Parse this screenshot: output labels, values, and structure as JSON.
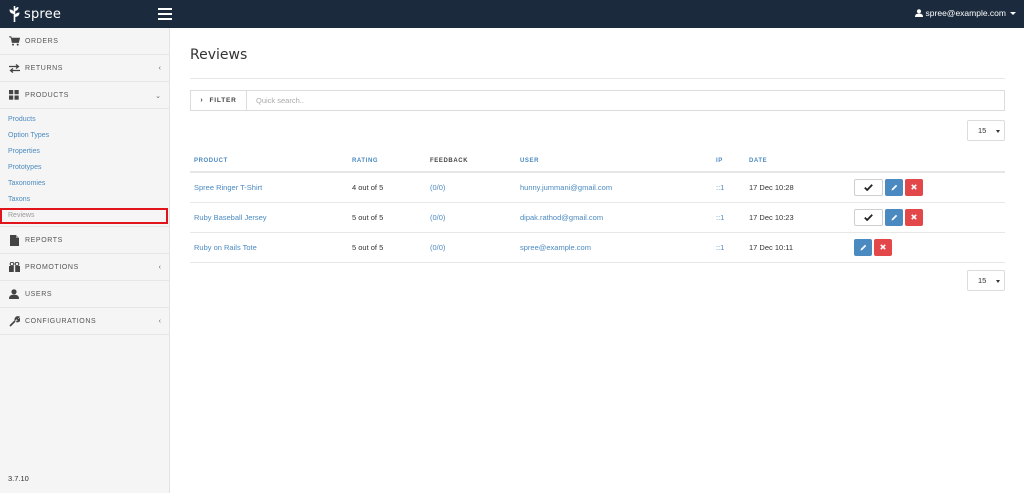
{
  "header": {
    "logo_text": "spree",
    "user_email": "spree@example.com",
    "icons": {
      "logo": "spree-logo-icon",
      "menu": "hamburger-menu-icon",
      "user": "user-icon"
    }
  },
  "sidebar": {
    "items": [
      {
        "label": "ORDERS",
        "icon": "cart-icon",
        "has_chevron": false
      },
      {
        "label": "RETURNS",
        "icon": "exchange-icon",
        "has_chevron": true
      },
      {
        "label": "PRODUCTS",
        "icon": "grid-icon",
        "has_chevron": true,
        "expanded": true
      },
      {
        "label": "REPORTS",
        "icon": "file-icon",
        "has_chevron": false
      },
      {
        "label": "PROMOTIONS",
        "icon": "gift-icon",
        "has_chevron": true
      },
      {
        "label": "USERS",
        "icon": "user-icon",
        "has_chevron": false
      },
      {
        "label": "CONFIGURATIONS",
        "icon": "wrench-icon",
        "has_chevron": true
      }
    ],
    "products_submenu": [
      {
        "label": "Products"
      },
      {
        "label": "Option Types"
      },
      {
        "label": "Properties"
      },
      {
        "label": "Prototypes"
      },
      {
        "label": "Taxonomies"
      },
      {
        "label": "Taxons"
      },
      {
        "label": "Reviews",
        "active": true
      }
    ],
    "version": "3.7.10"
  },
  "main": {
    "title": "Reviews",
    "filter": {
      "label": "FILTER",
      "placeholder": "Quick search.."
    },
    "per_page": "15",
    "table": {
      "columns": [
        "PRODUCT",
        "RATING",
        "FEEDBACK",
        "USER",
        "IP",
        "DATE"
      ],
      "rows": [
        {
          "product": "Spree Ringer T-Shirt",
          "rating": "4 out of 5",
          "feedback": "(0/0)",
          "user": "hunny.jummani@gmail.com",
          "ip": "::1",
          "date": "17 Dec 10:28",
          "approve": true
        },
        {
          "product": "Ruby Baseball Jersey",
          "rating": "5 out of 5",
          "feedback": "(0/0)",
          "user": "dipak.rathod@gmail.com",
          "ip": "::1",
          "date": "17 Dec 10:23",
          "approve": true
        },
        {
          "product": "Ruby on Rails Tote",
          "rating": "5 out of 5",
          "feedback": "(0/0)",
          "user": "spree@example.com",
          "ip": "::1",
          "date": "17 Dec 10:11",
          "approve": false
        }
      ]
    }
  },
  "colors": {
    "topbar": "#1b2a3c",
    "link": "#4b8ac0",
    "danger": "#e2484a",
    "highlight": "#e2141b"
  }
}
